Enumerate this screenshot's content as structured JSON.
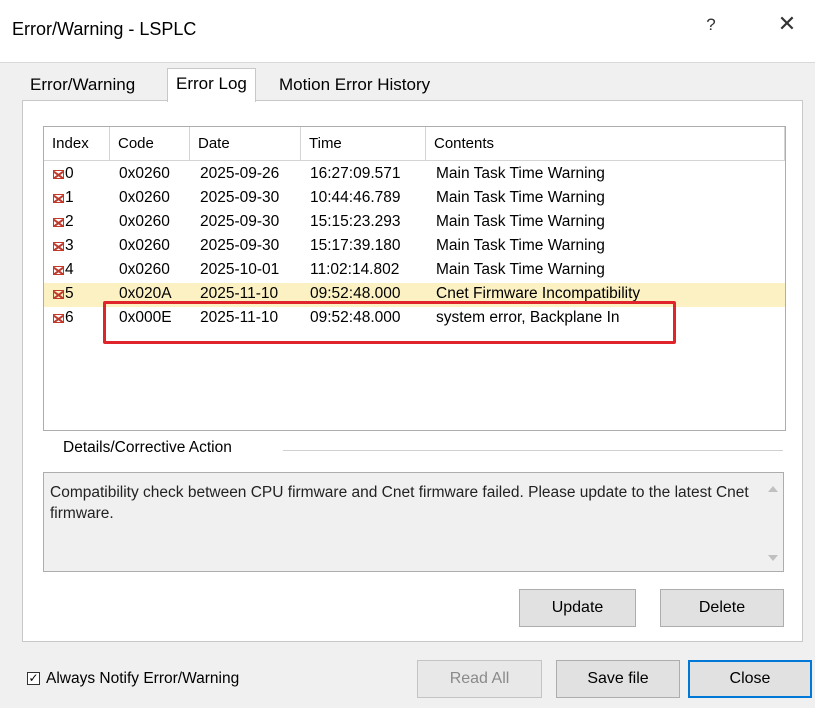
{
  "window": {
    "title": "Error/Warning - LSPLC",
    "help_glyph": "?",
    "close_glyph": "✕"
  },
  "tabs": [
    {
      "label": "Error/Warning",
      "active": false
    },
    {
      "label": "Error Log",
      "active": true
    },
    {
      "label": "Motion Error History",
      "active": false
    }
  ],
  "log": {
    "columns": [
      "Index",
      "Code",
      "Date",
      "Time",
      "Contents"
    ],
    "rows": [
      {
        "index": "0",
        "code": "0x0260",
        "date": "2025-09-26",
        "time": "16:27:09.571",
        "contents": "Main Task Time Warning"
      },
      {
        "index": "1",
        "code": "0x0260",
        "date": "2025-09-30",
        "time": "10:44:46.789",
        "contents": "Main Task Time Warning"
      },
      {
        "index": "2",
        "code": "0x0260",
        "date": "2025-09-30",
        "time": "15:15:23.293",
        "contents": "Main Task Time Warning"
      },
      {
        "index": "3",
        "code": "0x0260",
        "date": "2025-09-30",
        "time": "15:17:39.180",
        "contents": "Main Task Time Warning"
      },
      {
        "index": "4",
        "code": "0x0260",
        "date": "2025-10-01",
        "time": "11:02:14.802",
        "contents": "Main Task Time Warning"
      },
      {
        "index": "5",
        "code": "0x020A",
        "date": "2025-11-10",
        "time": "09:52:48.000",
        "contents": "Cnet Firmware Incompatibility"
      },
      {
        "index": "6",
        "code": "0x000E",
        "date": "2025-11-10",
        "time": "09:52:48.000",
        "contents": "system error, Backplane In"
      }
    ],
    "selected_index": "5"
  },
  "details": {
    "label": "Details/Corrective Action",
    "text": "Compatibility check between CPU firmware and Cnet firmware failed. Please update to the latest Cnet firmware."
  },
  "buttons": {
    "update": "Update",
    "delete": "Delete",
    "read_all": "Read All",
    "save_file": "Save file",
    "close": "Close"
  },
  "always_notify": {
    "label": "Always Notify Error/Warning",
    "checked": true,
    "check_glyph": "✓"
  },
  "colors": {
    "selected_row": "#fcf1c3",
    "highlight_box": "#e0242b",
    "default_button_border": "#0078d7"
  }
}
